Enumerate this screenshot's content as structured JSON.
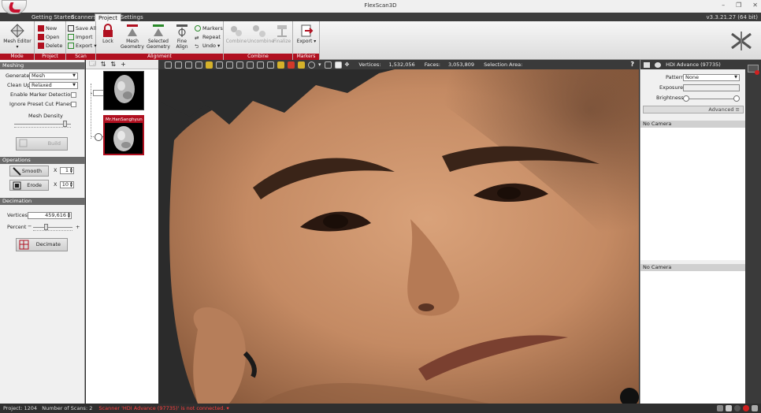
{
  "window": {
    "title": "FlexScan3D",
    "version": "v3.3.21.27 (64 bit)",
    "controls": [
      "–",
      "❐",
      "✕"
    ]
  },
  "tabs": [
    "Getting Started",
    "Scanners",
    "Project",
    "Settings"
  ],
  "active_tab": "Project",
  "ribbon": {
    "mode": {
      "label": "Mode",
      "mesh_editor": "Mesh Editor ▾"
    },
    "project": {
      "label": "Project",
      "new": "New",
      "open": "Open",
      "delete": "Delete"
    },
    "scan": {
      "label": "Scan",
      "save_all": "Save All",
      "import": "Import",
      "export": "Export ▾"
    },
    "alignment": {
      "label": "Alignment",
      "lock": "Lock",
      "mesh_geometry": "Mesh Geometry",
      "selected_geometry": "Selected Geometry",
      "fine_align": "Fine Align",
      "markers": "Markers",
      "repeat": "Repeat",
      "undo": "Undo ▾"
    },
    "combine": {
      "label": "Combine",
      "combine": "Combine",
      "uncombine": "Uncombine",
      "finalize": "Finalize"
    },
    "markers": {
      "label": "Markers",
      "export": "Export ▾"
    }
  },
  "left": {
    "meshing": {
      "header": "Meshing",
      "generate_label": "Generate",
      "generate_value": "Mesh",
      "cleanup_label": "Clean Up",
      "cleanup_value": "Relaxed",
      "marker_detection": "Enable Marker Detection",
      "ignore_cut_planes": "Ignore Preset Cut Planes",
      "mesh_density": "Mesh Density",
      "build": "Build",
      "mesh_density_level": 0.92
    },
    "operations": {
      "header": "Operations",
      "smooth": "Smooth",
      "smooth_x": "X",
      "smooth_value": "1",
      "erode": "Erode",
      "erode_x": "X",
      "erode_value": "10"
    },
    "decimation": {
      "header": "Decimation",
      "vertices_label": "Vertices",
      "vertices_value": "459,616",
      "percent_label": "Percent",
      "minus": "−",
      "plus": "+",
      "decimate": "Decimate",
      "percent_level": 0.3
    }
  },
  "thumbs": {
    "items": [
      {
        "label": ""
      },
      {
        "label": "Mr.HanSanghyun"
      }
    ],
    "tools": [
      "🗔",
      "⇅",
      "⇅",
      "+"
    ]
  },
  "viewport": {
    "vertices_label": "Vertices:",
    "vertices": "1,532,056",
    "faces_label": "Faces:",
    "faces": "3,053,809",
    "selection_label": "Selection Area:",
    "help": "?"
  },
  "right": {
    "scanner": "HDI Advance (97735)",
    "pattern_label": "Pattern",
    "pattern_value": "None",
    "exposure_label": "Exposure",
    "brightness_label": "Brightness",
    "advanced": "Advanced ≡",
    "camera1": "No Camera",
    "camera2": "No Camera"
  },
  "status": {
    "project": "Project: 1204",
    "scans": "Number of Scans: 2",
    "warning": "Scanner 'HDI Advance (97735)' is not connected. ▾"
  },
  "colors": {
    "accent": "#b01020",
    "ribbon_group_label": "#b01020",
    "highlight": "#d6b22a"
  }
}
